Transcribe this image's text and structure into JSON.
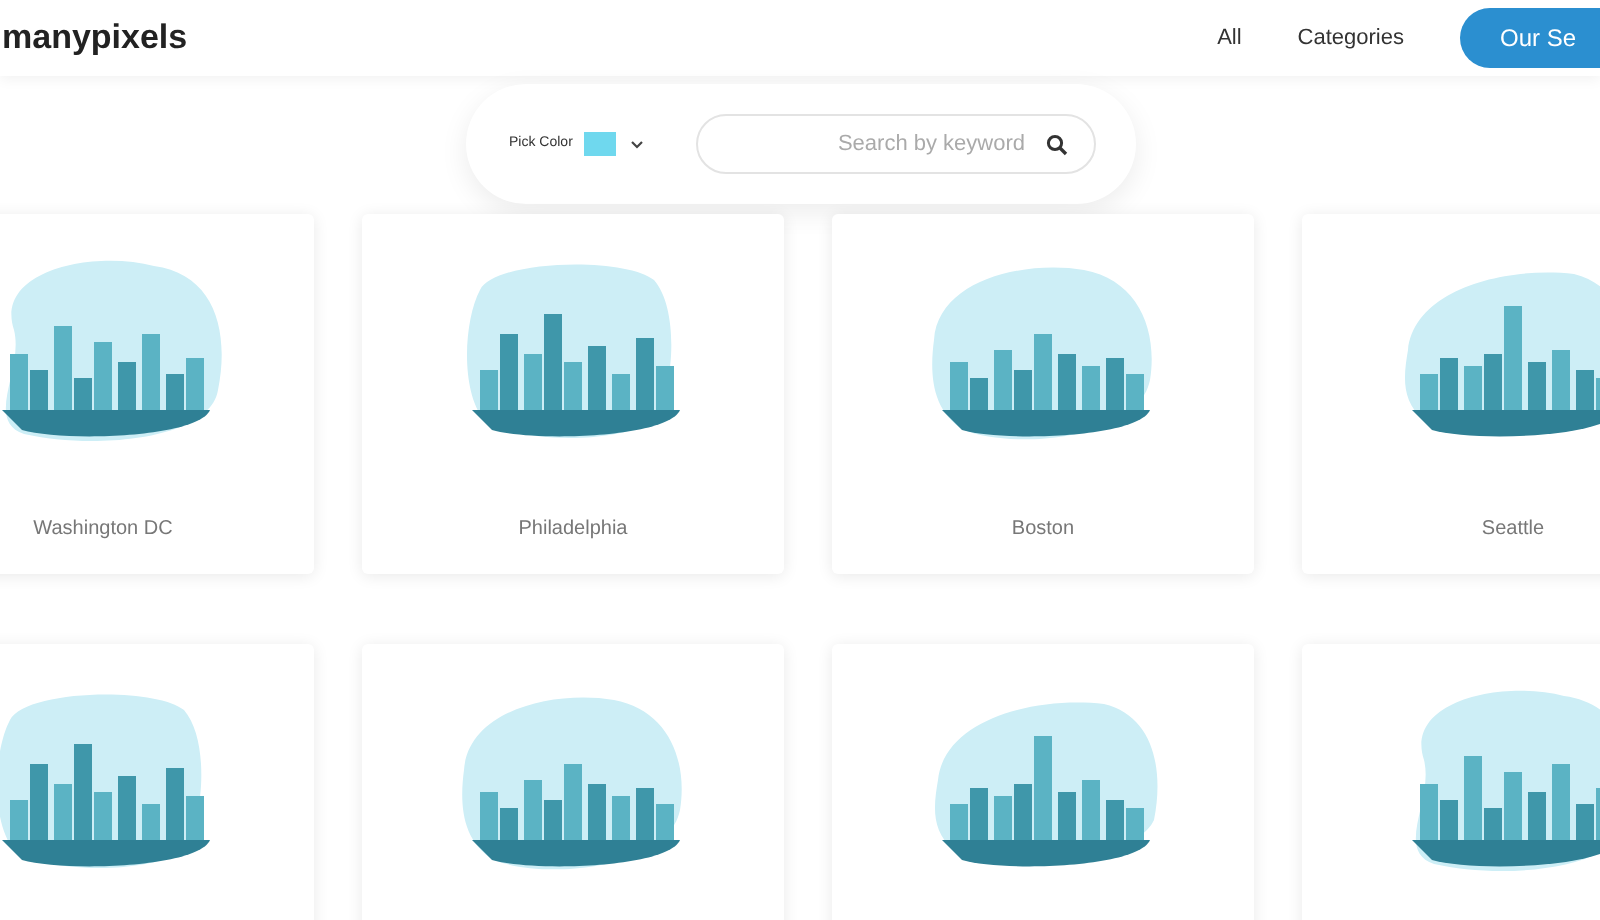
{
  "header": {
    "logo": "manypixels",
    "nav": [
      {
        "label": "All"
      },
      {
        "label": "Categories"
      }
    ],
    "cta": "Our Se"
  },
  "filter": {
    "color_label": "Pick Color",
    "color": "#6fd8ee",
    "search_placeholder": "Search by keyword"
  },
  "rows": [
    {
      "cards": [
        {
          "kind": "skyline",
          "title": "Washington DC"
        },
        {
          "kind": "skyline",
          "title": "Philadelphia"
        },
        {
          "kind": "skyline",
          "title": "Boston"
        },
        {
          "kind": "skyline",
          "title": "Seattle"
        }
      ]
    },
    {
      "cards": [
        {
          "kind": "skyline"
        },
        {
          "kind": "skyline"
        },
        {
          "kind": "skyline"
        },
        {
          "kind": "skyline"
        }
      ]
    }
  ]
}
